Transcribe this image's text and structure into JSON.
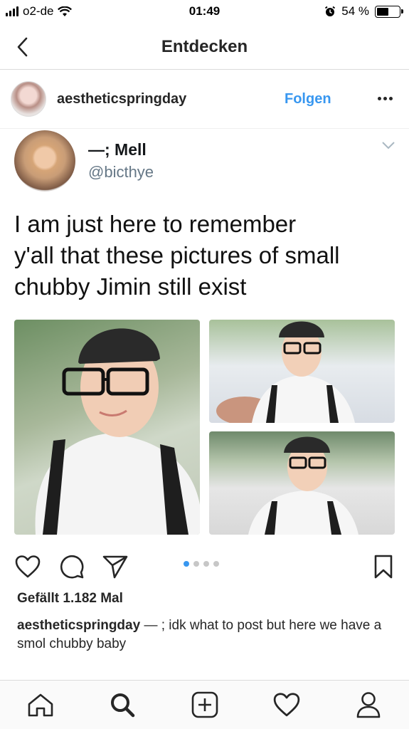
{
  "status_bar": {
    "carrier": "o2-de",
    "time": "01:49",
    "battery_percent": "54 %",
    "battery_level": 0.54
  },
  "nav": {
    "title": "Entdecken"
  },
  "post_header": {
    "username": "aestheticspringday",
    "follow_label": "Folgen"
  },
  "tweet": {
    "name": "—; Mell",
    "handle": "@bicthye",
    "text": "I am just here  to remember\ny'all that these pictures of small\nchubby Jimin still exist"
  },
  "actions": {
    "icons": [
      "heart-icon",
      "comment-icon",
      "share-icon",
      "bookmark-icon"
    ],
    "carousel_dots": 4,
    "carousel_active_index": 0
  },
  "likes": "Gefällt 1.182 Mal",
  "caption": {
    "username": "aestheticspringday",
    "text": " — ; idk what to post but here we have a smol chubby baby"
  },
  "tab_bar": {
    "icons": [
      "home-icon",
      "search-icon",
      "add-post-icon",
      "activity-heart-icon",
      "profile-icon"
    ]
  },
  "colors": {
    "accent": "#3897f0",
    "text": "#262626",
    "divider": "#dbdbdb"
  }
}
